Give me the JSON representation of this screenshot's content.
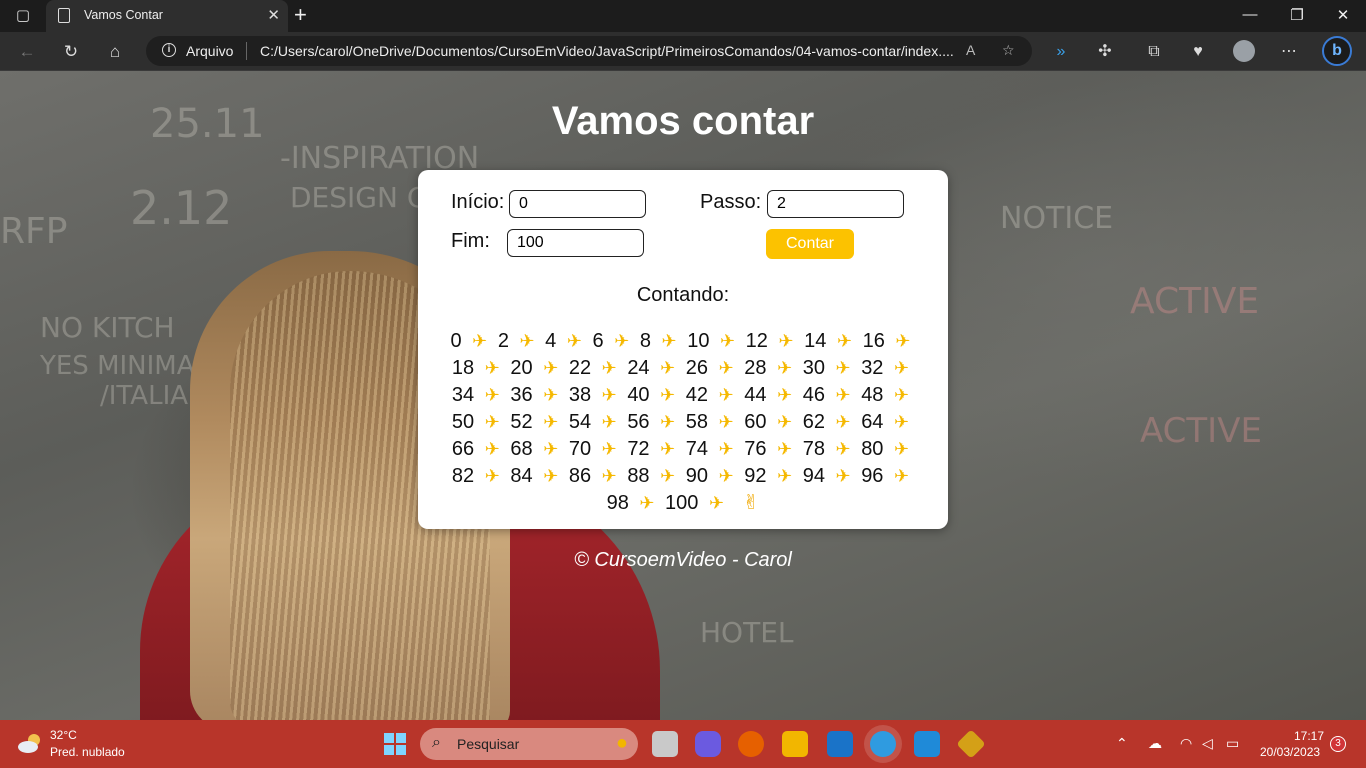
{
  "browser": {
    "tab_title": "Vamos Contar",
    "scheme_label": "Arquivo",
    "url": "C:/Users/carol/OneDrive/Documentos/CursoEmVideo/JavaScript/PrimeirosComandos/04-vamos-contar/index...."
  },
  "page": {
    "title": "Vamos contar",
    "form": {
      "inicio_label": "Início:",
      "inicio_value": "0",
      "passo_label": "Passo:",
      "passo_value": "2",
      "fim_label": "Fim:",
      "fim_value": "100",
      "button_label": "Contar"
    },
    "result_heading": "Contando:",
    "sequence": [
      "0",
      "2",
      "4",
      "6",
      "8",
      "10",
      "12",
      "14",
      "16",
      "18",
      "20",
      "22",
      "24",
      "26",
      "28",
      "30",
      "32",
      "34",
      "36",
      "38",
      "40",
      "42",
      "44",
      "46",
      "48",
      "50",
      "52",
      "54",
      "56",
      "58",
      "60",
      "62",
      "64",
      "66",
      "68",
      "70",
      "72",
      "74",
      "76",
      "78",
      "80",
      "82",
      "84",
      "86",
      "88",
      "90",
      "92",
      "94",
      "96",
      "98",
      "100"
    ],
    "separator_glyph": "✈",
    "end_glyph": "✌",
    "footer": "© CursoemVideo - Carol"
  },
  "taskbar": {
    "weather_temp": "32°C",
    "weather_desc": "Pred. nublado",
    "search_placeholder": "Pesquisar",
    "clock_time": "17:17",
    "clock_date": "20/03/2023",
    "notification_count": "3"
  },
  "colors": {
    "accent_button": "#fcc200",
    "taskbar": "#b8352a"
  }
}
